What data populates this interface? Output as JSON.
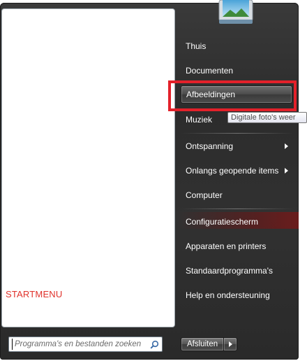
{
  "left_pane": {
    "label": "STARTMENU",
    "search": {
      "placeholder": "Programma's en bestanden zoeken",
      "value": ""
    }
  },
  "right_pane": {
    "items": [
      {
        "label": "Thuis",
        "has_submenu": false
      },
      {
        "label": "Documenten",
        "has_submenu": false
      },
      {
        "label": "Afbeeldingen",
        "has_submenu": false,
        "state": "hover"
      },
      {
        "label": "Muziek",
        "has_submenu": false
      },
      {
        "label": "Ontspanning",
        "has_submenu": true
      },
      {
        "label": "Onlangs geopende items",
        "has_submenu": true
      },
      {
        "label": "Computer",
        "has_submenu": false
      },
      {
        "label": "Configuratiescherm",
        "has_submenu": false
      },
      {
        "label": "Apparaten en printers",
        "has_submenu": false
      },
      {
        "label": "Standaardprogramma's",
        "has_submenu": false
      },
      {
        "label": "Help en ondersteuning",
        "has_submenu": false
      }
    ],
    "tooltip": "Digitale foto's weer"
  },
  "shutdown": {
    "label": "Afsluiten"
  },
  "icons": {
    "user_picture": "user-picture-icon",
    "search": "search-icon",
    "submenu_arrow": "arrow-right-icon",
    "shutdown_options": "arrow-right-icon"
  },
  "colors": {
    "highlight": "#e3212a",
    "menu_background": "#2f2f2f",
    "label_red": "#e0322b"
  }
}
